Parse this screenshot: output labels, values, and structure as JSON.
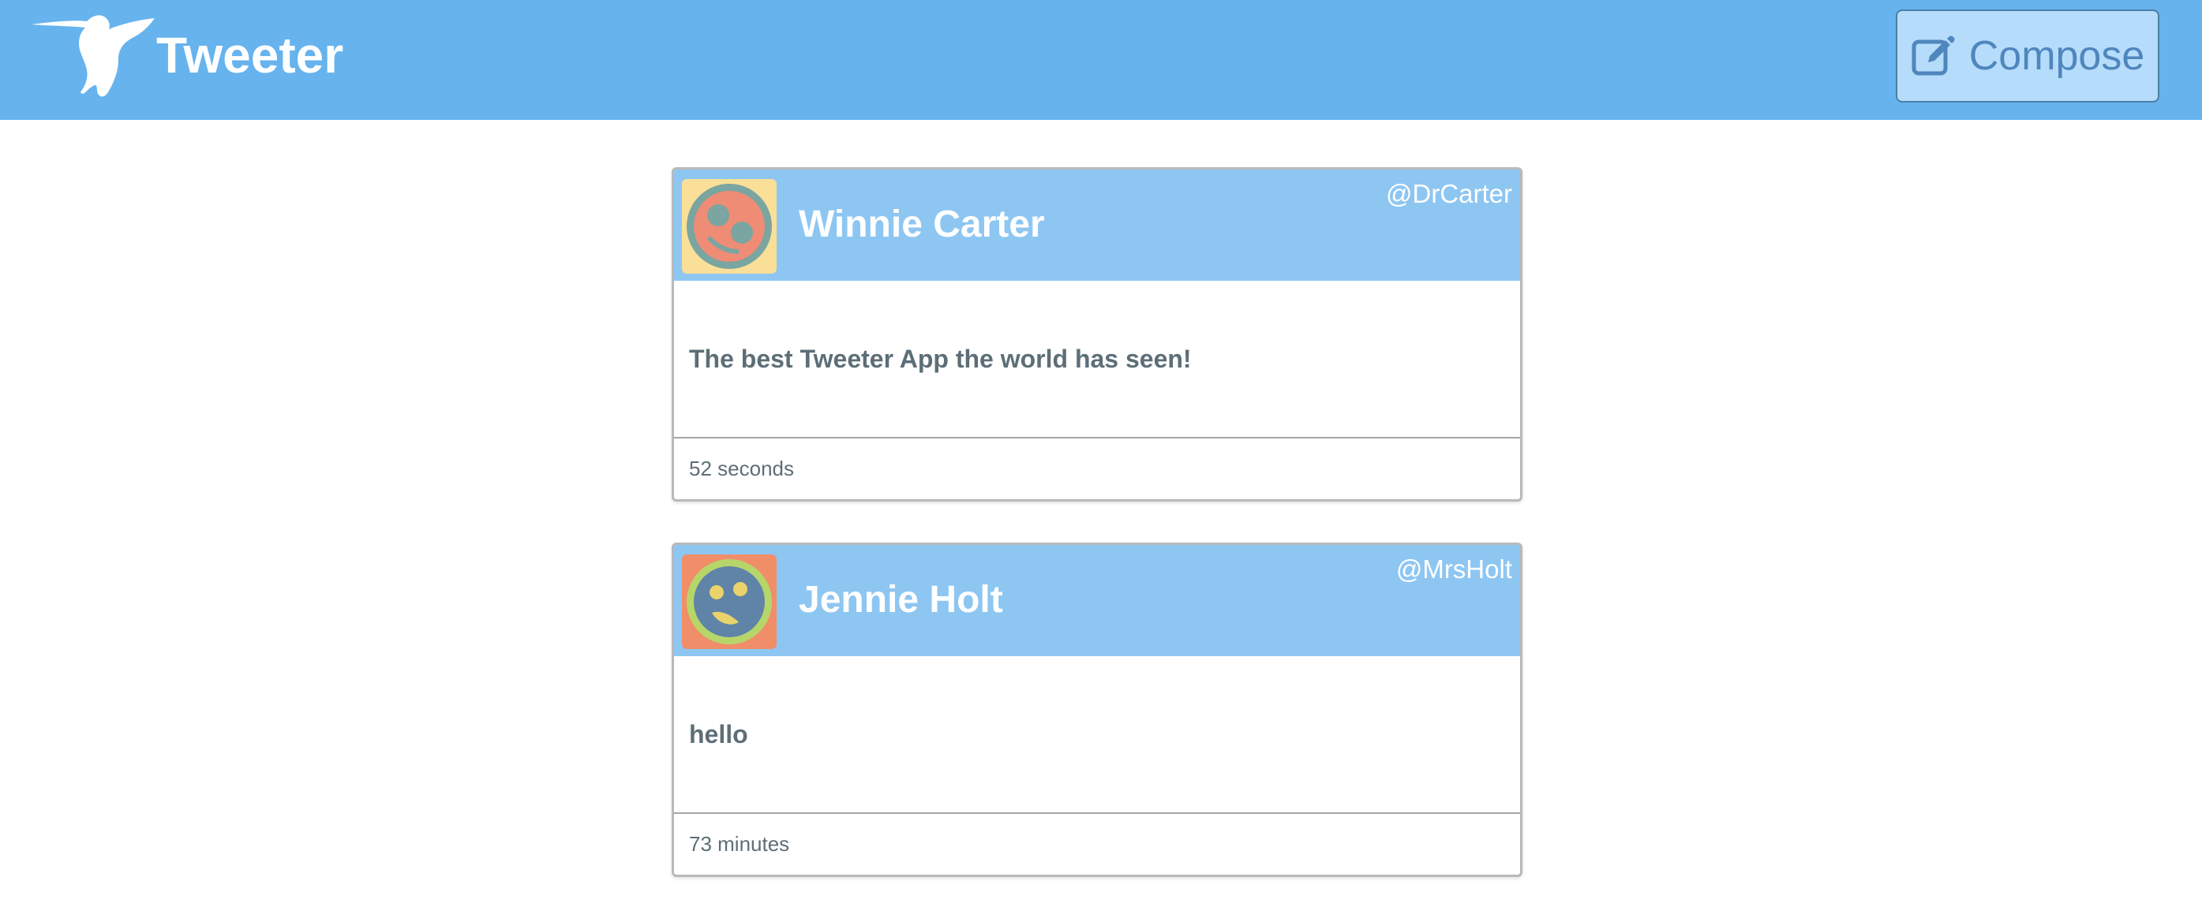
{
  "app": {
    "title": "Tweeter",
    "logo_icon": "hummingbird-icon"
  },
  "header": {
    "compose_label": "Compose",
    "compose_icon": "edit-icon"
  },
  "colors": {
    "navbar": "#66b3ee",
    "tweet_header": "#8ec6f2",
    "compose_bg": "#b5dcfa",
    "text": "#5d6e77"
  },
  "tweets": [
    {
      "name": "Winnie Carter",
      "handle": "@DrCarter",
      "text": "The best Tweeter App the world has seen!",
      "time": "52 seconds",
      "avatar_icon": "avatar-icon"
    },
    {
      "name": "Jennie Holt",
      "handle": "@MrsHolt",
      "text": "hello",
      "time": "73 minutes",
      "avatar_icon": "avatar-icon"
    }
  ]
}
